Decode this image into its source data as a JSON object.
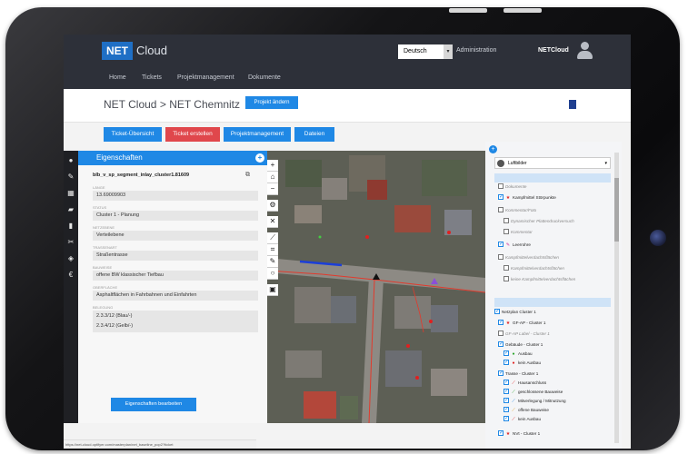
{
  "app": {
    "logo": "NET",
    "name": "Cloud",
    "language": "Deutsch",
    "admin": "Administration",
    "user": "NETCloud"
  },
  "nav": [
    "Home",
    "Tickets",
    "Projektmanagement",
    "Dokumente"
  ],
  "breadcrumb": {
    "parent": "NET Cloud",
    "separator": ">",
    "current": "NET Chemnitz"
  },
  "project_button": "Projekt ändern",
  "actions": [
    "Ticket-Übersicht",
    "Ticket erstellen",
    "Projektmanagement",
    "Dateien"
  ],
  "properties": {
    "title": "Eigenschaften",
    "segment": "blb_v_sp_segment_inlay_cluster1.81609",
    "fields": [
      {
        "label": "Länge",
        "value": "13.69009903"
      },
      {
        "label": "Status",
        "value": "Cluster 1 - Planung"
      },
      {
        "label": "Netzebene",
        "value": "Verteilebene"
      },
      {
        "label": "Trassenart",
        "value": "Straßentrasse"
      },
      {
        "label": "Bauweise",
        "value": "offene BW klassischer Tiefbau"
      },
      {
        "label": "Oberfläche",
        "value": "Asphaltflächen in Fahrbahnen und Einfahrten"
      }
    ],
    "belegung_label": "Belegung",
    "belegung_values": [
      "2.3.3/12 (Blau/-)",
      "2.3.4/12 (Gelb/-)"
    ],
    "edit_button": "Eigenschaften bearbeiten"
  },
  "layers": {
    "basemap": "Luftbilder",
    "rows": [
      {
        "text": "Dokumente",
        "style": "italic",
        "checked": false,
        "icon": ""
      },
      {
        "text": "Kampfmittel Störpunkte",
        "style": "normal",
        "checked": true,
        "icon": "star"
      },
      {
        "text": "Kommentar/Foto",
        "style": "italic",
        "checked": false,
        "icon": ""
      },
      {
        "text": "Dynamischer Plattendruckversuch",
        "style": "italic",
        "checked": false,
        "icon": ""
      },
      {
        "text": "Kommentar",
        "style": "italic",
        "checked": false,
        "icon": ""
      },
      {
        "text": "Leerrohre",
        "style": "normal",
        "checked": true,
        "icon": "pen"
      },
      {
        "text": "Kampfmittelverdachtsflächen",
        "style": "italic",
        "checked": false,
        "icon": ""
      },
      {
        "text": "Kampfmittelverdachtsflächen",
        "style": "italic",
        "checked": false,
        "icon": ""
      },
      {
        "text": "keine Kampfmittelverdachtsflächen",
        "style": "italic",
        "checked": false,
        "icon": ""
      },
      {
        "text": "Netzplan Cluster 1",
        "style": "normal",
        "checked": true,
        "icon": ""
      },
      {
        "text": "GF-AP - Cluster 1",
        "style": "normal",
        "checked": true,
        "icon": "star"
      },
      {
        "text": "GF-AP Label - Cluster 1",
        "style": "italic",
        "checked": false,
        "icon": ""
      },
      {
        "text": "Gebäude - Cluster 1",
        "style": "normal",
        "checked": true,
        "icon": ""
      },
      {
        "text": "Ausbau",
        "style": "normal",
        "checked": true,
        "icon": "green-dot"
      },
      {
        "text": "kein Ausbau",
        "style": "normal",
        "checked": true,
        "icon": "red-dot"
      },
      {
        "text": "Trasse - Cluster 1",
        "style": "normal",
        "checked": true,
        "icon": ""
      },
      {
        "text": "Hausanschluss",
        "style": "normal",
        "checked": true,
        "icon": "line"
      },
      {
        "text": "geschlossene Bauweise",
        "style": "normal",
        "checked": true,
        "icon": "line"
      },
      {
        "text": "Mitverlegung / Mitnutzung",
        "style": "normal",
        "checked": true,
        "icon": "line"
      },
      {
        "text": "offene Bauweise",
        "style": "normal",
        "checked": true,
        "icon": "line"
      },
      {
        "text": "kein Ausbau",
        "style": "normal",
        "checked": true,
        "icon": "line"
      },
      {
        "text": "NVt - Cluster 1",
        "style": "normal",
        "checked": true,
        "icon": "star"
      }
    ]
  },
  "status_url": "https://net-cloud.optifyer.com/masterplan/net_baseline_pop2?ticket"
}
